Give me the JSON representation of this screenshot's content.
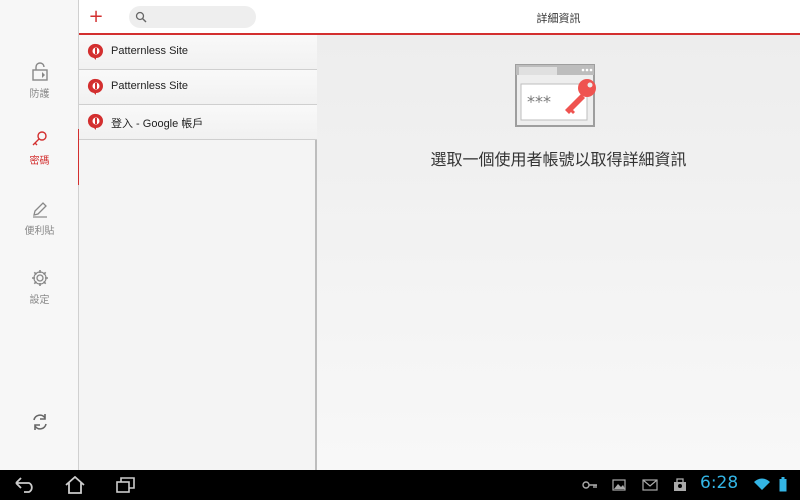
{
  "nav": {
    "items": [
      {
        "label": "防護",
        "icon": "lock-icon"
      },
      {
        "label": "密碼",
        "icon": "key-icon",
        "active": true
      },
      {
        "label": "便利貼",
        "icon": "pencil-icon"
      },
      {
        "label": "設定",
        "icon": "gear-icon"
      }
    ],
    "sync_icon": "sync-icon"
  },
  "list": {
    "search_placeholder": "",
    "items": [
      {
        "label": "Patternless Site"
      },
      {
        "label": "Patternless Site"
      },
      {
        "label": "登入 - Google 帳戶"
      }
    ]
  },
  "detail": {
    "title": "詳細資訊",
    "empty_message": "選取一個使用者帳號以取得詳細資訊",
    "illustration_text": "***"
  },
  "system_bar": {
    "time": "6:28"
  },
  "colors": {
    "accent": "#d32f2f",
    "clock": "#33b5e5"
  }
}
